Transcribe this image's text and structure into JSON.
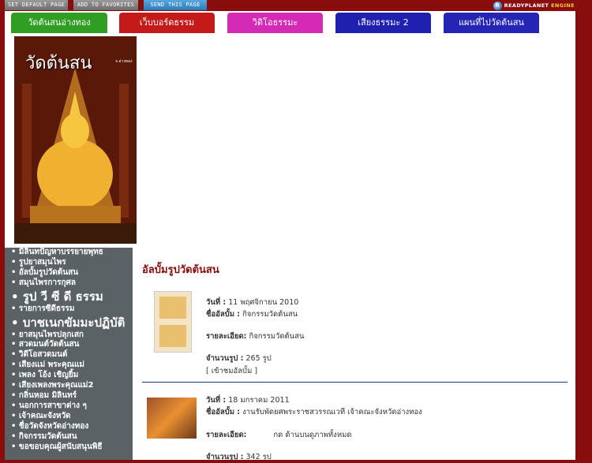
{
  "toolbar": {
    "set_default": "SET DEFAULT PAGE",
    "add_favorites": "ADD TO FAVORITES",
    "send_page": "SEND THIS PAGE",
    "brand_a": "READYPLANET",
    "brand_b": "ENGINE",
    "brand_ball": "R"
  },
  "tabs": [
    {
      "label": "วัดต้นสนอ่างทอง",
      "color": "#2f9e22"
    },
    {
      "label": "เว็บบอร์ดธรรม",
      "color": "#c41a1a"
    },
    {
      "label": "วิดิโอธรรมะ",
      "color": "#d52ab5"
    },
    {
      "label": "เสียงธรรมะ 2",
      "color": "#1f1fb0"
    },
    {
      "label": "แผนที่ไปวัดต้นสน",
      "color": "#2424b5"
    }
  ],
  "hero": {
    "title": "วัดต้นสน",
    "subtitle": "จ.อ่างทอง"
  },
  "sidebar": {
    "items": [
      {
        "label": "มิลินทปัญหาบรรยายพุทธ",
        "big": false
      },
      {
        "label": "รูปยาสมุนไพร",
        "big": false
      },
      {
        "label": "อัลบั้มรูปวัดต้นสน",
        "big": false
      },
      {
        "label": "สมุนไพรการกุศล",
        "big": false
      },
      {
        "label": "รูป วี ซี ดี ธรรม",
        "big": true
      },
      {
        "label": "รายการซีดีธรรม",
        "big": false
      },
      {
        "label": "บาชเนกขัมมะปฏิบัติ",
        "big": true
      },
      {
        "label": "ยาสมุนไพรปลุกเสก",
        "big": false
      },
      {
        "label": "สวดมนต์วัดต้นสน",
        "big": false
      },
      {
        "label": "วิดีโอสวดมนต์",
        "big": false
      },
      {
        "label": "เสียงแม่ พระคุณแม่",
        "big": false
      },
      {
        "label": "เพลง โอ้ง เชิญยิ้ม",
        "big": false
      },
      {
        "label": "เสียงเพลงพระคุณแม่2",
        "big": false
      },
      {
        "label": "กลิ่นหอม มิลินทร์",
        "big": false
      },
      {
        "label": "นอกการสาขาต่าง ๆ",
        "big": false
      },
      {
        "label": "เจ้าคณะจังหวัด",
        "big": false
      },
      {
        "label": "ชื่อวัดจังหวัดอ่างทอง",
        "big": false
      },
      {
        "label": "กิจกรรมวัดต้นสน",
        "big": false
      },
      {
        "label": "ขอขอบคุณผู้สนับสนุนพิธี",
        "big": false
      }
    ]
  },
  "content": {
    "heading": "อัลบั้มรูปวัดต้นสน",
    "albums": [
      {
        "date_label": "วันที่ :",
        "date": "11 พฤศจิกายน 2010",
        "name_label": "ชื่ออัลบั้ม :",
        "name": "กิจกรรมวัดต้นสน",
        "detail_label": "รายละเอียด:",
        "detail": "กิจกรรมวัดต้นสน",
        "count_label": "จำนวนรูป :",
        "count": "265 รูป",
        "enter": "[ เข้าชมอัลบั้ม ]"
      },
      {
        "date_label": "วันที่ :",
        "date": "18 มกราคม 2011",
        "name_label": "ชื่ออัลบั้ม :",
        "name": "งานรับพัดยศพระราชสวรรณเวที เจ้าคณะจังหวัดอ่างทอง",
        "detail_label": "รายละเอียด:",
        "detail": "กด ด้านบนดูภาพทั้งหมด",
        "count_label": "จำนวนรูป :",
        "count": "342 รูป"
      }
    ]
  }
}
